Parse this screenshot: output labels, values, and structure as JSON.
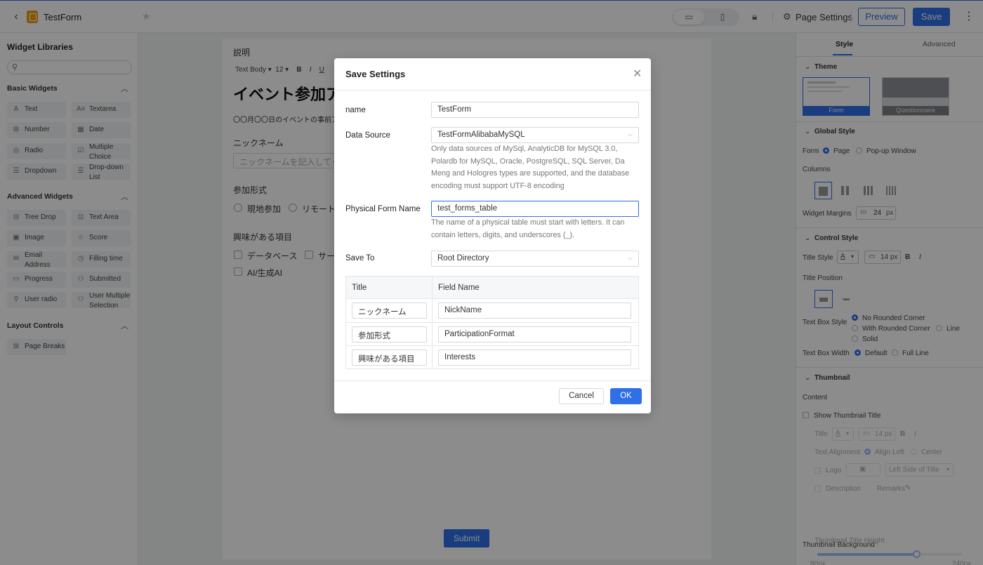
{
  "topbar": {
    "app_title": "TestForm",
    "page_settings": "Page Settings",
    "preview": "Preview",
    "save": "Save"
  },
  "left_panel": {
    "title": "Widget Libraries",
    "sections": [
      {
        "title": "Basic Widgets",
        "widgets": [
          {
            "icon": "text-icon",
            "label": "Text"
          },
          {
            "icon": "textarea-icon",
            "label": "Textarea"
          },
          {
            "icon": "number-icon",
            "label": "Number"
          },
          {
            "icon": "date-icon",
            "label": "Date"
          },
          {
            "icon": "radio-icon",
            "label": "Radio"
          },
          {
            "icon": "multiple-choice-icon",
            "label": "Multiple Choice"
          },
          {
            "icon": "dropdown-icon",
            "label": "Dropdown"
          },
          {
            "icon": "dropdown-list-icon",
            "label": "Drop-down List"
          }
        ]
      },
      {
        "title": "Advanced Widgets",
        "widgets": [
          {
            "icon": "tree-drop-icon",
            "label": "Tree Drop"
          },
          {
            "icon": "text-area-icon",
            "label": "Text Area"
          },
          {
            "icon": "image-icon",
            "label": "Image"
          },
          {
            "icon": "score-icon",
            "label": "Score"
          },
          {
            "icon": "email-icon",
            "label": "Email Address"
          },
          {
            "icon": "filling-time-icon",
            "label": "Filling time"
          },
          {
            "icon": "progress-icon",
            "label": "Progress"
          },
          {
            "icon": "submitted-icon",
            "label": "Submitted"
          },
          {
            "icon": "user-radio-icon",
            "label": "User radio"
          },
          {
            "icon": "user-multiple-icon",
            "label": "User Multiple Selection"
          }
        ]
      },
      {
        "title": "Layout Controls",
        "widgets": [
          {
            "icon": "page-breaks-icon",
            "label": "Page Breaks"
          }
        ]
      }
    ]
  },
  "canvas": {
    "desc_label": "説明",
    "toolbar": [
      "Text Body ▾",
      "12 ▾",
      "B",
      "I",
      "U"
    ],
    "heading": "イベント参加ア",
    "intro": "〇〇月〇〇日のイベントの事前ア",
    "q1_label": "ニックネーム",
    "q1_placeholder": "ニックネームを記入してく",
    "q2_label": "参加形式",
    "q2_options": [
      "現地参加",
      "リモート"
    ],
    "q3_label": "興味がある項目",
    "q3_options": [
      "データベース",
      "サー",
      "AI/生成AI"
    ],
    "submit": "Submit"
  },
  "right_panel": {
    "tabs": [
      "Style",
      "Advanced"
    ],
    "theme": {
      "title": "Theme",
      "options": [
        "Form",
        "Questionnaire"
      ]
    },
    "global_style": {
      "title": "Global Style",
      "form_label": "Form",
      "form_options": [
        "Page",
        "Pop-up Window"
      ],
      "columns_label": "Columns",
      "widget_margins_label": "Widget Margins",
      "widget_margins_value": "24",
      "unit": "px"
    },
    "control_style": {
      "title": "Control Style",
      "title_style_label": "Title Style",
      "title_style_size": "14",
      "unit": "px",
      "title_position_label": "Title Position",
      "text_box_style_label": "Text Box Style",
      "text_box_style_options": [
        "No Rounded Corner",
        "With Rounded Corner",
        "Line",
        "Solid"
      ],
      "text_box_width_label": "Text Box Width",
      "text_box_width_options": [
        "Default",
        "Full Line"
      ]
    },
    "thumbnail": {
      "title": "Thumbnail",
      "content_label": "Content",
      "show_title": "Show Thumbnail Title",
      "title_label": "Title",
      "title_size": "14",
      "unit": "px",
      "text_alignment_label": "Text Alignment",
      "alignment_options": [
        "Align Left",
        "Center"
      ],
      "logo_label": "Logo",
      "logo_position": "Left Side of Title",
      "description_label": "Description",
      "remarks": "Remarks",
      "height_label": "Thumbnail Title Height",
      "height_min": "80px",
      "height_max": "240px",
      "height_value_fraction": 0.69,
      "background_label": "Thumbnail Background"
    }
  },
  "modal": {
    "title": "Save Settings",
    "name_label": "name",
    "name_value": "TestForm",
    "ds_label": "Data Source",
    "ds_value": "TestFormAlibabaMySQL",
    "ds_help": "Only data sources of MySql, AnalyticDB for MySQL 3.0, Polardb for MySQL, Oracle, PostgreSQL, SQL Server, Da Meng and Hologres types are supported, and the database encoding must support UTF-8 encoding",
    "pfn_label": "Physical Form Name",
    "pfn_value": "test_forms_table",
    "pfn_help": "The name of a physical table must start with letters. It can contain letters, digits, and underscores (_).",
    "save_to_label": "Save To",
    "save_to_value": "Root Directory",
    "table": {
      "headers": [
        "Title",
        "Field Name"
      ],
      "rows": [
        {
          "title": "ニックネーム",
          "field": "NickName"
        },
        {
          "title": "参加形式",
          "field": "ParticipationFormat"
        },
        {
          "title": "興味がある項目",
          "field": "Interests"
        }
      ]
    },
    "cancel": "Cancel",
    "ok": "OK"
  },
  "colors": {
    "accent": "#2f6fe8",
    "overlay": "rgba(0,0,0,0.45)"
  }
}
